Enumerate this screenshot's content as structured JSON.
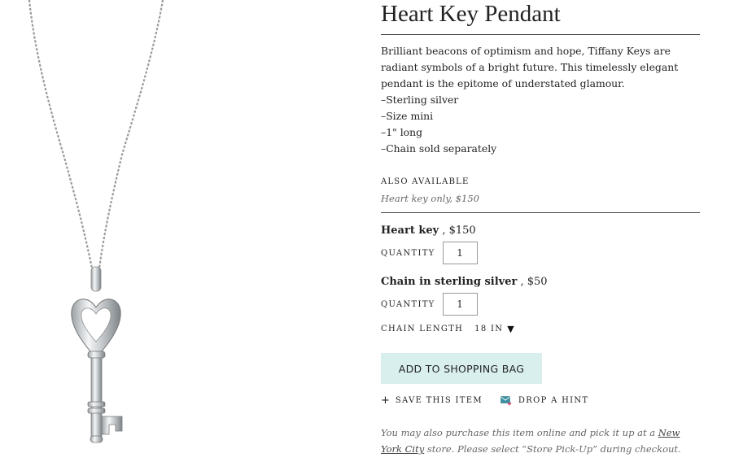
{
  "product": {
    "title": "Heart Key Pendant",
    "description": "Brilliant beacons of optimism and hope, Tiffany Keys are radiant symbols of a bright future. This timelessly elegant pendant is the epitome of understated glamour.",
    "features": [
      "–Sterling silver",
      "–Size mini",
      "–1\" long",
      "–Chain sold separately"
    ]
  },
  "also_available": {
    "label": "ALSO AVAILABLE",
    "item": "Heart key only, $150"
  },
  "items": [
    {
      "name": "Heart key",
      "price": " , $150",
      "quantity_label": "QUANTITY",
      "quantity": "1"
    },
    {
      "name": "Chain in sterling silver",
      "price": " , $50",
      "quantity_label": "QUANTITY",
      "quantity": "1"
    }
  ],
  "chain_length": {
    "label": "CHAIN LENGTH",
    "value": "18 IN"
  },
  "buttons": {
    "add_to_bag": "ADD TO SHOPPING BAG",
    "save": "SAVE THIS ITEM",
    "hint": "DROP A HINT"
  },
  "footnote": {
    "text_before": "You may also purchase this item online and pick it up at a ",
    "link": "New York City",
    "text_after": " store. Please select “Store Pick-Up” during checkout."
  },
  "colors": {
    "accent_button": "#d8efee",
    "hint_icon": "#3a8fa0"
  },
  "icons": {
    "plus": "plus-icon",
    "hint": "envelope-heart-icon",
    "dropdown": "triangle-down-icon"
  }
}
